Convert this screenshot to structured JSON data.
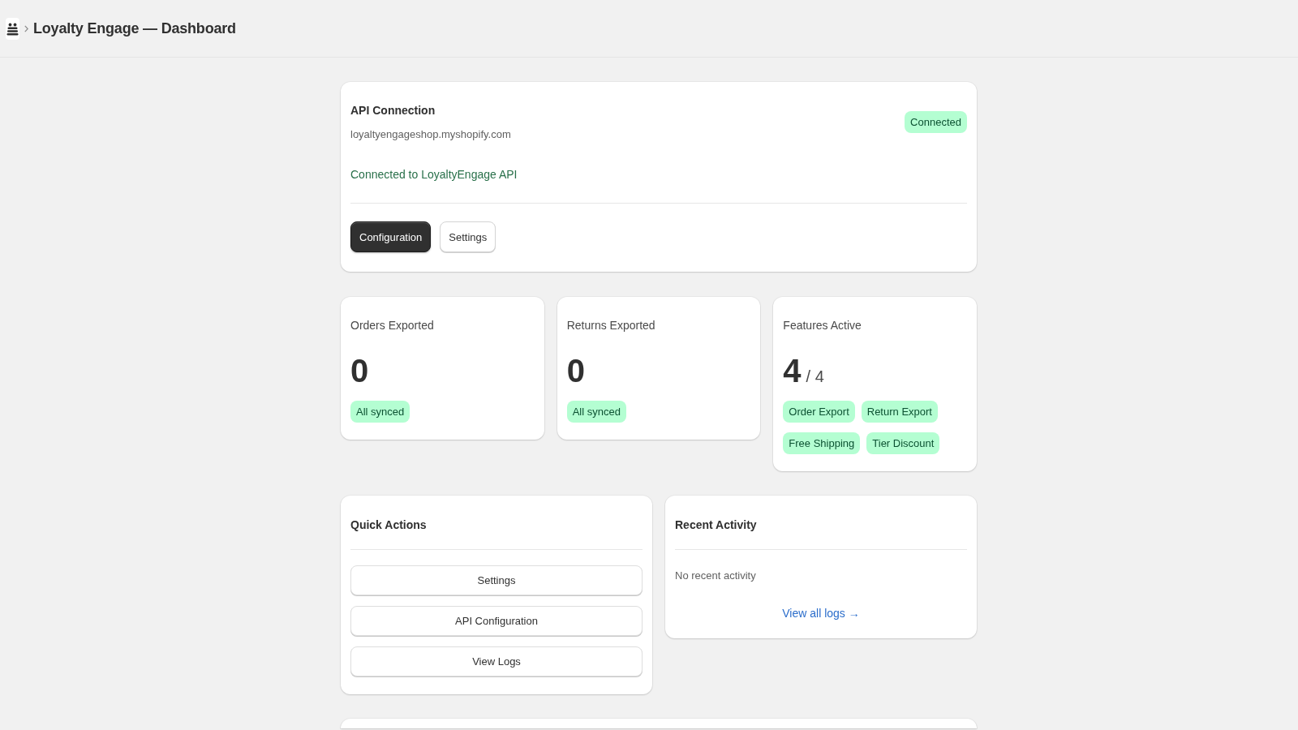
{
  "header": {
    "title": "Loyalty Engage — Dashboard"
  },
  "api_connection": {
    "title": "API Connection",
    "domain": "loyaltyengageshop.myshopify.com",
    "status": "Connected",
    "message": "Connected to LoyaltyEngage API",
    "buttons": [
      {
        "label": "Configuration",
        "kind": "primary"
      },
      {
        "label": "Settings",
        "kind": "secondary"
      }
    ]
  },
  "stats": [
    {
      "label": "Orders Exported",
      "value": "0",
      "badges": [
        "All synced"
      ]
    },
    {
      "label": "Returns Exported",
      "value": "0",
      "badges": [
        "All synced"
      ]
    },
    {
      "label": "Features Active",
      "value": "4",
      "total": "/ 4",
      "badges": [
        "Order Export",
        "Return Export",
        "Free Shipping",
        "Tier Discount"
      ]
    }
  ],
  "quick_actions": {
    "title": "Quick Actions",
    "buttons": [
      "Settings",
      "API Configuration",
      "View Logs"
    ]
  },
  "recent_activity": {
    "title": "Recent Activity",
    "empty_message": "No recent activity",
    "link": "View all logs →"
  }
}
